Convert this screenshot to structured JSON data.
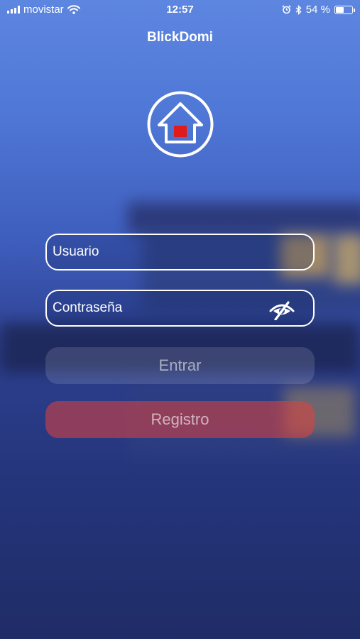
{
  "status_bar": {
    "carrier": "movistar",
    "time": "12:57",
    "battery_percent": "54 %",
    "battery_level": 0.54
  },
  "app": {
    "title": "BlickDomi"
  },
  "logo": {
    "icon": "house-icon",
    "accent_color": "#e01b1b"
  },
  "form": {
    "username_placeholder": "Usuario",
    "password_placeholder": "Contraseña",
    "password_toggle_icon": "eye-slash-icon"
  },
  "buttons": {
    "login_label": "Entrar",
    "register_label": "Registro"
  }
}
